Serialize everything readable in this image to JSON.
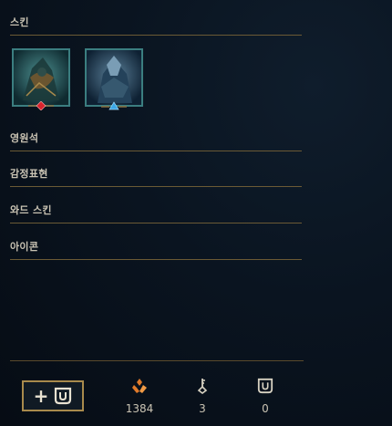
{
  "sections": {
    "skins_title": "스킨",
    "gemstones_title": "영원석",
    "emotes_title": "감정표현",
    "ward_skins_title": "와드 스킨",
    "icons_title": "아이콘"
  },
  "skins": [
    {
      "name": "skin-1",
      "gem": "red-gem-icon"
    },
    {
      "name": "skin-2",
      "gem": "blue-triangle-icon"
    }
  ],
  "footer": {
    "add_button_icon": "loot-chest-icon",
    "orange_essence": "1384",
    "keys": "3",
    "chests": "0"
  },
  "colors": {
    "accent_gold": "#a88a4c",
    "essence_orange": "#e07a2a",
    "frame_teal": "#3b7e80"
  }
}
